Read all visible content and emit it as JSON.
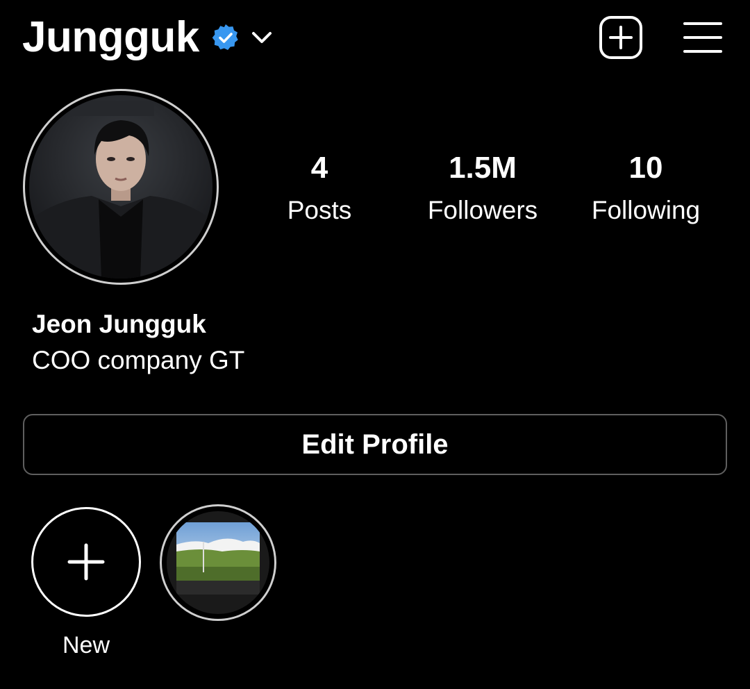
{
  "header": {
    "username": "Jungguk",
    "verified_icon": "verified-badge-icon",
    "dropdown_icon": "chevron-down-icon",
    "new_post_icon": "add-post-icon",
    "menu_icon": "hamburger-menu-icon"
  },
  "stats": {
    "posts": {
      "value": "4",
      "label": "Posts"
    },
    "followers": {
      "value": "1.5M",
      "label": "Followers"
    },
    "following": {
      "value": "10",
      "label": "Following"
    }
  },
  "profile": {
    "full_name": "Jeon Jungguk",
    "bio": "COO company GT"
  },
  "actions": {
    "edit_profile_label": "Edit Profile"
  },
  "highlights": {
    "new_label": "New"
  },
  "colors": {
    "background": "#000000",
    "text": "#ffffff",
    "verified_blue": "#3897f0",
    "button_border": "#5f5f5f"
  }
}
